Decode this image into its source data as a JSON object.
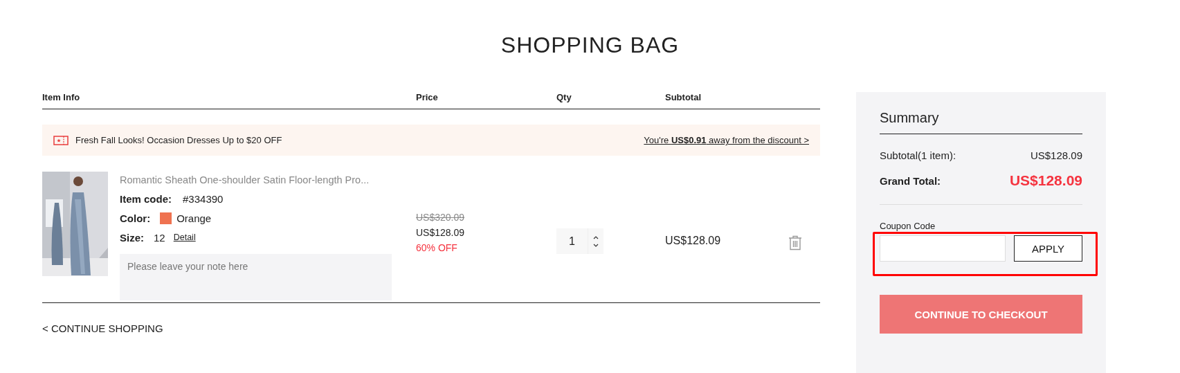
{
  "page_title": "SHOPPING BAG",
  "table": {
    "columns": [
      "Item Info",
      "Price",
      "Qty",
      "Subtotal"
    ]
  },
  "promo": {
    "text": "Fresh Fall Looks! Occasion Dresses Up to $20 OFF",
    "link": "You're **US$0.91** away from the discount >"
  },
  "items": [
    {
      "kind": "picture",
      "name": "Romantic Sheath One-shoulder Satin Floor-length Pro...",
      "code_label": "Item code:",
      "code": "#334390",
      "color_label": "Color:",
      "color_name": "Orange",
      "color": "#ef7250",
      "size_label": "Size:",
      "size": "12",
      "detail_link": "Detail",
      "note_placeholder": "Please leave your note here",
      "original_price": "US$320.09",
      "price": "US$128.09",
      "discount": "60% OFF",
      "qty": "1",
      "subtotal": "US$128.09"
    }
  ],
  "continue_shopping": "< CONTINUE SHOPPING",
  "summary": {
    "title": "Summary",
    "rows": [
      {
        "label": "Subtotal(1 item):",
        "value": "US$128.09",
        "kind": "plain"
      },
      {
        "label": "Grand Total:",
        "value": "US$128.09",
        "kind": "total"
      }
    ],
    "coupon": {
      "label": "Coupon Code",
      "button": "APPLY",
      "highlighted": true
    },
    "checkout": "CONTINUE TO CHECKOUT"
  }
}
